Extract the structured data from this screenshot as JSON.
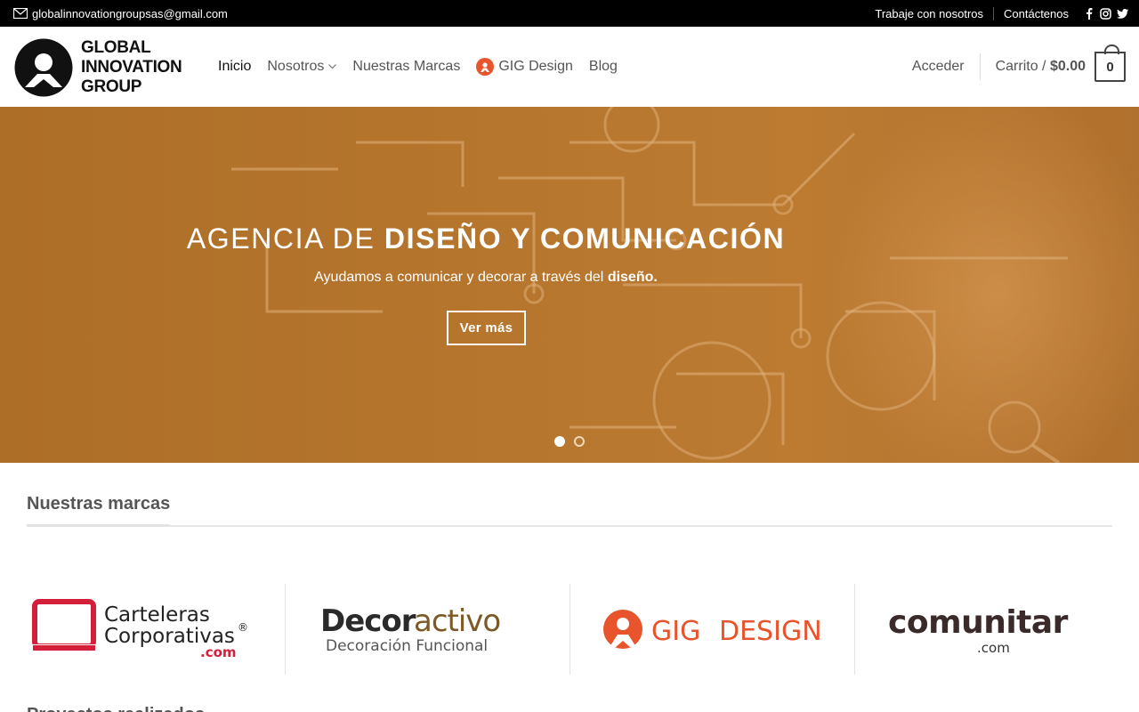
{
  "topbar": {
    "email": "globalinnovationgroupsas@gmail.com",
    "links": [
      "Trabaje con nosotros",
      "Contáctenos"
    ],
    "social": [
      "facebook-icon",
      "instagram-icon",
      "twitter-icon"
    ]
  },
  "header": {
    "logo_lines": [
      "GLOBAL",
      "INNOVATION",
      "GROUP"
    ],
    "nav": [
      {
        "label": "Inicio"
      },
      {
        "label": "Nosotros"
      },
      {
        "label": "Nuestras Marcas"
      },
      {
        "label": "GIG Design"
      },
      {
        "label": "Blog"
      }
    ],
    "login": "Acceder",
    "cart_label": "Carrito /",
    "cart_total": "$0.00",
    "cart_count": "0"
  },
  "hero": {
    "title_light": "AGENCIA DE",
    "title_bold": "DISEÑO Y COMUNICACIÓN",
    "subtitle": "Ayudamos a comunicar y decorar a través del",
    "subtitle_bold": "diseño.",
    "button": "Ver más",
    "slides": 2,
    "active_slide": 1
  },
  "brands": {
    "title": "Nuestras marcas",
    "items": [
      {
        "line1": "Carteleras",
        "line2": "Corporativas",
        "suffix": ".com",
        "mark": "®"
      },
      {
        "line1_a": "Decor",
        "line1_b": "activo",
        "line2": "Decoración Funcional"
      },
      {
        "part_a": "GIG",
        "part_b": "DESIGN"
      },
      {
        "name": "comunitar",
        "suffix": ".com"
      }
    ]
  },
  "next_section": {
    "title": "Proyectos realizados"
  },
  "colors": {
    "hero": "#bd7a2f",
    "brand_red": "#d41f3a",
    "brand_orange": "#e8542b",
    "brand_brown": "#7b5a25"
  }
}
